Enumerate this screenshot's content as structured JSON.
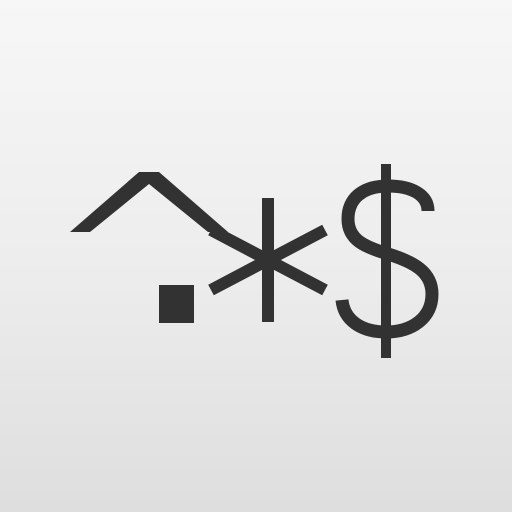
{
  "icon": {
    "glyphs": [
      "^",
      ".",
      "*",
      "$"
    ],
    "regex_text": "^.*$",
    "glyph_color": "#323232",
    "background_top": "#f7f7f7",
    "background_bottom": "#dedede"
  }
}
